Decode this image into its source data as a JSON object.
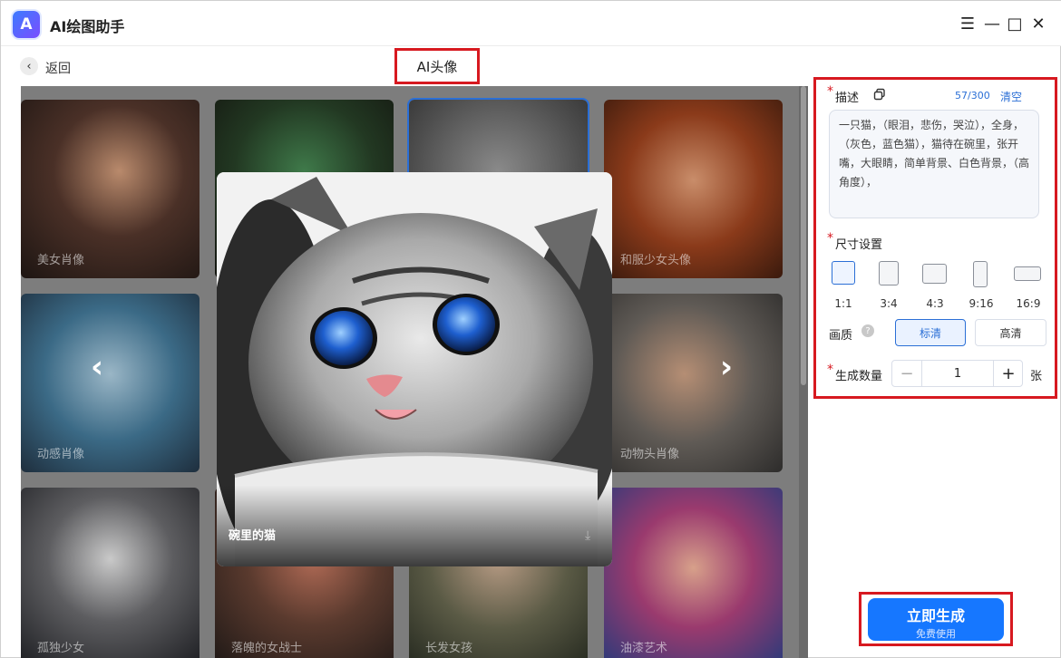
{
  "app": {
    "logo_text": "A",
    "title": "AI绘图助手"
  },
  "window_controls": {
    "menu": "☰",
    "minimize": "—",
    "maximize": "□",
    "close": "✕"
  },
  "nav": {
    "back_label": "返回",
    "page_title": "AI头像"
  },
  "gallery": {
    "cards": [
      {
        "label": "美女肖像"
      },
      {
        "label": ""
      },
      {
        "label": ""
      },
      {
        "label": "和服少女头像"
      },
      {
        "label": "动感肖像"
      },
      {
        "label": "动物头肖像"
      },
      {
        "label": "孤独少女"
      },
      {
        "label": "落魄的女战士"
      },
      {
        "label": "长发女孩"
      },
      {
        "label": "油漆艺术"
      }
    ],
    "preview_caption": "碗里的猫",
    "prev_arrow": "‹",
    "next_arrow": "›"
  },
  "panel": {
    "required_mark": "*",
    "desc_label": "描述",
    "char_count": "57/300",
    "clear_label": "清空",
    "description": "一只猫，（眼泪，悲伤，哭泣），全身，（灰色，蓝色猫），猫待在碗里，张开嘴，大眼睛，简单背景、白色背景，（高角度），",
    "size_label": "尺寸设置",
    "ratios": [
      "1:1",
      "3:4",
      "4:3",
      "9:16",
      "16:9"
    ],
    "selected_ratio": "1:1",
    "quality_label": "画质",
    "quality_help": "?",
    "quality_options": [
      "标清",
      "高清"
    ],
    "selected_quality": "标清",
    "count_label": "生成数量",
    "count_minus": "−",
    "count_value": "1",
    "count_plus": "+",
    "count_unit": "张"
  },
  "generate": {
    "main_label": "立即生成",
    "sub_label": "免费使用"
  },
  "colors": {
    "accent": "#1677ff",
    "highlight_border": "#d71920"
  }
}
